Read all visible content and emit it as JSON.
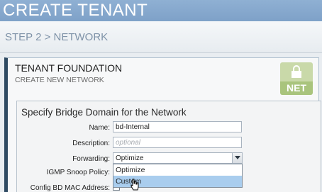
{
  "header": {
    "title": "CREATE TENANT"
  },
  "step": {
    "label": "STEP 2 > NETWORK"
  },
  "panel": {
    "title": "TENANT FOUNDATION",
    "subtitle": "CREATE NEW NETWORK",
    "badge_text": "NET",
    "badge_icon": "lock-icon"
  },
  "bridge_domain": {
    "title": "Specify Bridge Domain for the Network",
    "fields": {
      "name": {
        "label": "Name:",
        "value": "bd-Internal"
      },
      "description": {
        "label": "Description:",
        "placeholder": "optional"
      },
      "forwarding": {
        "label": "Forwarding:",
        "selected": "Optimize",
        "options": [
          "Optimize",
          "Custom"
        ],
        "highlighted": "Custom"
      },
      "igmp": {
        "label": "IGMP Snoop Policy:"
      },
      "config_bd_mac": {
        "label": "Config BD MAC Address:"
      }
    }
  },
  "colors": {
    "banner": "#8fb0d3",
    "panel_accent": "#2f4a62",
    "badge_green": "#a9c47d",
    "dropdown_highlight": "#a9cdee"
  }
}
